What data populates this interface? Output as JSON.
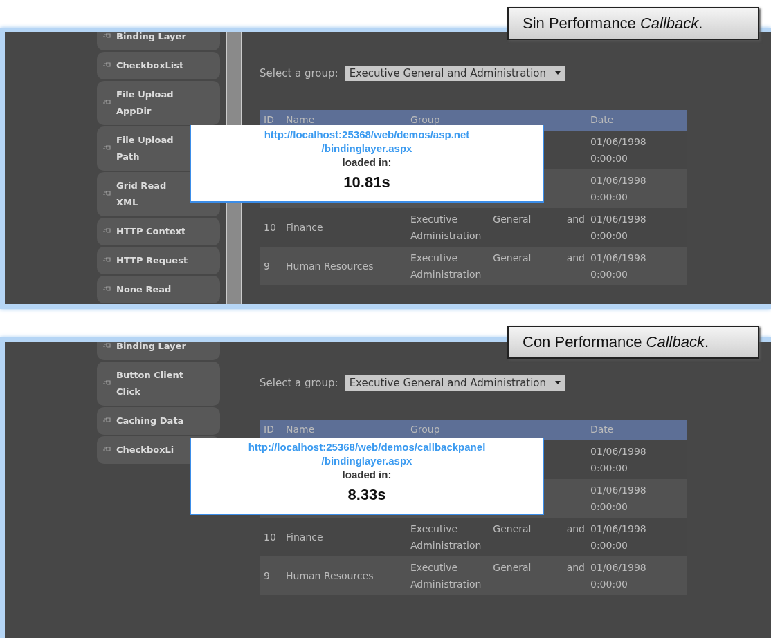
{
  "panels": [
    {
      "caption": "Sin Performance *Callback*.",
      "splitter": true,
      "sidebar": [
        "Binding Layer",
        "CheckboxList",
        "File Upload AppDir",
        "File Upload Path",
        "Grid Read XML",
        "HTTP Context",
        "HTTP Request",
        "None Read"
      ],
      "select_label": "Select a group:",
      "select_value": "Executive General and Administration",
      "columns": [
        "ID",
        "Name",
        "Group",
        "Date"
      ],
      "rows": [
        {
          "date": "01/06/1998 0:00:00"
        },
        {
          "date": "01/06/1998 0:00:00"
        },
        {
          "id": "10",
          "name": "Finance",
          "group": "Executive General and Administration",
          "date": "01/06/1998 0:00:00"
        },
        {
          "id": "9",
          "name": "Human Resources",
          "group": "Executive General and Administration",
          "date": "01/06/1998 0:00:00"
        }
      ],
      "popup": {
        "url_lines": [
          "http://localhost:25368/web/demos/asp.net",
          "/bindinglayer.aspx"
        ],
        "label": "loaded in:",
        "time": "10.81s"
      }
    },
    {
      "caption": "Con Performance *Callback*.",
      "splitter": false,
      "sidebar": [
        "Binding Layer",
        "Button Client Click",
        "Caching Data",
        "CheckboxLi"
      ],
      "select_label": "Select a group:",
      "select_value": "Executive General and Administration",
      "columns": [
        "ID",
        "Name",
        "Group",
        "Date"
      ],
      "rows": [
        {
          "date": "01/06/1998 0:00:00"
        },
        {
          "date": "01/06/1998 0:00:00"
        },
        {
          "id": "10",
          "name": "Finance",
          "group": "Executive General and Administration",
          "date": "01/06/1998 0:00:00"
        },
        {
          "id": "9",
          "name": "Human Resources",
          "group": "Executive General and Administration",
          "date": "01/06/1998 0:00:00"
        }
      ],
      "popup": {
        "url_lines": [
          "http://localhost:25368/web/demos/callbackpanel",
          "/bindinglayer.aspx"
        ],
        "label": "loaded in:",
        "time": "8.33s"
      }
    }
  ]
}
